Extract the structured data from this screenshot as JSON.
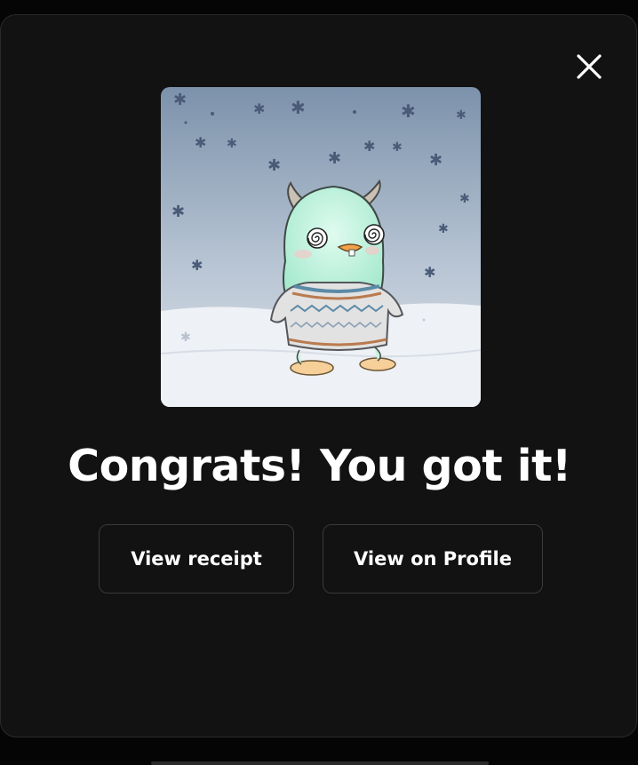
{
  "modal": {
    "close_icon": "close-icon",
    "headline": "Congrats! You got it!",
    "artwork": {
      "subject": "penguin-in-sweater-nft",
      "background_top": "#7f93aa",
      "background_bottom": "#d9dee6",
      "snow_ground": "#eef1f5",
      "body_color": "#c8f3df",
      "sweater_color": "#e3e3e3"
    },
    "buttons": {
      "receipt_label": "View receipt",
      "profile_label": "View on Profile"
    }
  },
  "colors": {
    "modal_bg": "#121212",
    "page_bg": "#050505",
    "button_border": "#3a3a3a",
    "text": "#ffffff"
  }
}
